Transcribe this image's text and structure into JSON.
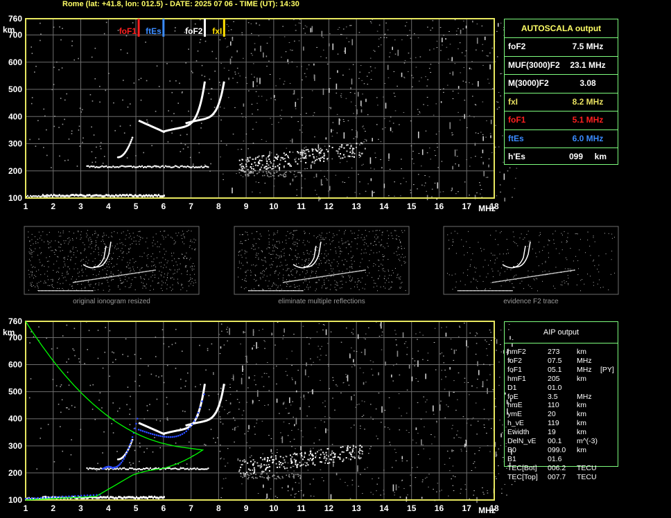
{
  "header": "Rome (lat: +41.8, lon: 012.5) - DATE: 2025 07 06 - TIME (UT): 14:30",
  "colors": {
    "grid": "#6e6e6e",
    "frame": "#e8e860",
    "foF1": "#ff2020",
    "ftEs": "#3a8bff",
    "foF2": "#ffffff",
    "fxI": "#ffe000",
    "profile": "#00ff00",
    "trace": "#2a4bff",
    "table_border": "#7fff7f",
    "fxI_text": "#e8e060",
    "label_yellow": "#ffff66"
  },
  "chart_data": [
    {
      "type": "scatter",
      "id": "main-ionogram",
      "xlabel": "MHz",
      "ylabel": "km",
      "xlim": [
        1,
        18
      ],
      "ylim": [
        100,
        760
      ],
      "x_ticks": [
        1,
        2,
        3,
        4,
        5,
        6,
        7,
        8,
        9,
        10,
        11,
        12,
        13,
        14,
        15,
        16,
        17,
        18
      ],
      "y_ticks": [
        100,
        200,
        300,
        400,
        500,
        600,
        700,
        760
      ],
      "grid": true,
      "markers": [
        {
          "name": "foF1",
          "freq": 5.1,
          "color": "#ff2020"
        },
        {
          "name": "ftEs",
          "freq": 6.0,
          "color": "#3a8bff"
        },
        {
          "name": "foF2",
          "freq": 7.5,
          "color": "#ffffff"
        },
        {
          "name": "fxI",
          "freq": 8.2,
          "color": "#ffe000"
        }
      ]
    },
    {
      "type": "scatter",
      "id": "aip-ionogram",
      "xlabel": "MHz",
      "ylabel": "km",
      "xlim": [
        1,
        18
      ],
      "ylim": [
        100,
        760
      ],
      "x_ticks": [
        1,
        2,
        3,
        4,
        5,
        6,
        7,
        8,
        9,
        10,
        11,
        12,
        13,
        14,
        15,
        16,
        17,
        18
      ],
      "y_ticks": [
        100,
        200,
        300,
        400,
        500,
        600,
        700,
        760
      ],
      "grid": true
    }
  ],
  "autoscala": {
    "title": "AUTOSCALA output",
    "rows": [
      {
        "key": "foF2",
        "value": "7.5 MHz",
        "color": "#ffffff"
      },
      {
        "key": "MUF(3000)F2",
        "value": "23.1 MHz",
        "color": "#ffffff"
      },
      {
        "key": "M(3000)F2",
        "value": "3.08",
        "color": "#ffffff"
      },
      {
        "key": "fxI",
        "value": "8.2 MHz",
        "color": "#e8e060"
      },
      {
        "key": "foF1",
        "value": "5.1 MHz",
        "color": "#ff2020"
      },
      {
        "key": "ftEs",
        "value": "6.0 MHz",
        "color": "#3a8bff"
      },
      {
        "key": "h'Es",
        "value": "099     km",
        "color": "#ffffff"
      }
    ]
  },
  "aip": {
    "title": "AIP output",
    "rows": [
      {
        "name": "hmF2",
        "value": "273",
        "unit": "km",
        "extra": ""
      },
      {
        "name": "foF2",
        "value": "07.5",
        "unit": "MHz",
        "extra": ""
      },
      {
        "name": "foF1",
        "value": "05.1",
        "unit": "MHz",
        "extra": "[PY]"
      },
      {
        "name": "hmF1",
        "value": "205",
        "unit": "km",
        "extra": ""
      },
      {
        "name": "D1",
        "value": "01.0",
        "unit": "",
        "extra": ""
      },
      {
        "name": "foE",
        "value": "3.5",
        "unit": "MHz",
        "extra": ""
      },
      {
        "name": "hmE",
        "value": "110",
        "unit": "km",
        "extra": ""
      },
      {
        "name": "ymE",
        "value": "20",
        "unit": "km",
        "extra": ""
      },
      {
        "name": "h_vE",
        "value": "119",
        "unit": "km",
        "extra": ""
      },
      {
        "name": "Ewidth",
        "value": "19",
        "unit": "km",
        "extra": ""
      },
      {
        "name": "DelN_vE",
        "value": "00.1",
        "unit": "m^(-3)",
        "extra": ""
      },
      {
        "name": "B0",
        "value": "099.0",
        "unit": "km",
        "extra": ""
      },
      {
        "name": "B1",
        "value": "01.6",
        "unit": "",
        "extra": ""
      },
      {
        "name": "TEC[Bot]",
        "value": "006.2",
        "unit": "TECU",
        "extra": ""
      },
      {
        "name": "TEC[Top]",
        "value": "007.7",
        "unit": "TECU",
        "extra": ""
      }
    ]
  },
  "thumbnails": [
    {
      "caption": "original ionogram resized"
    },
    {
      "caption": "eliminate multiple reflections"
    },
    {
      "caption": "evidence F2 trace"
    }
  ]
}
